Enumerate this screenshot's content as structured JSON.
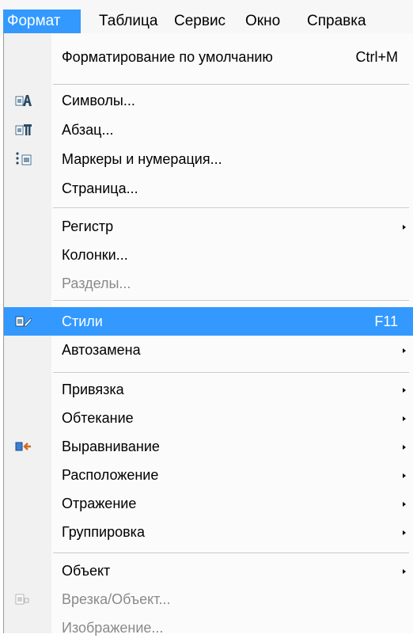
{
  "menubar": {
    "items": [
      {
        "label": "Формат",
        "active": true
      },
      {
        "label": "Таблица"
      },
      {
        "label": "Сервис"
      },
      {
        "label": "Окно"
      },
      {
        "label": "Справка"
      }
    ]
  },
  "menu": {
    "items": [
      {
        "label": "Форматирование по умолчанию",
        "shortcut": "Ctrl+M"
      },
      {
        "label": "Символы..."
      },
      {
        "label": "Абзац..."
      },
      {
        "label": "Маркеры и нумерация..."
      },
      {
        "label": "Страница..."
      },
      {
        "label": "Регистр"
      },
      {
        "label": "Колонки..."
      },
      {
        "label": "Разделы..."
      },
      {
        "label": "Стили",
        "shortcut": "F11"
      },
      {
        "label": "Автозамена"
      },
      {
        "label": "Привязка"
      },
      {
        "label": "Обтекание"
      },
      {
        "label": "Выравнивание"
      },
      {
        "label": "Расположение"
      },
      {
        "label": "Отражение"
      },
      {
        "label": "Группировка"
      },
      {
        "label": "Объект"
      },
      {
        "label": "Врезка/Объект..."
      },
      {
        "label": "Изображение..."
      }
    ]
  },
  "colors": {
    "highlight": "#3399ff",
    "disabled_text": "#8a8a8a"
  }
}
